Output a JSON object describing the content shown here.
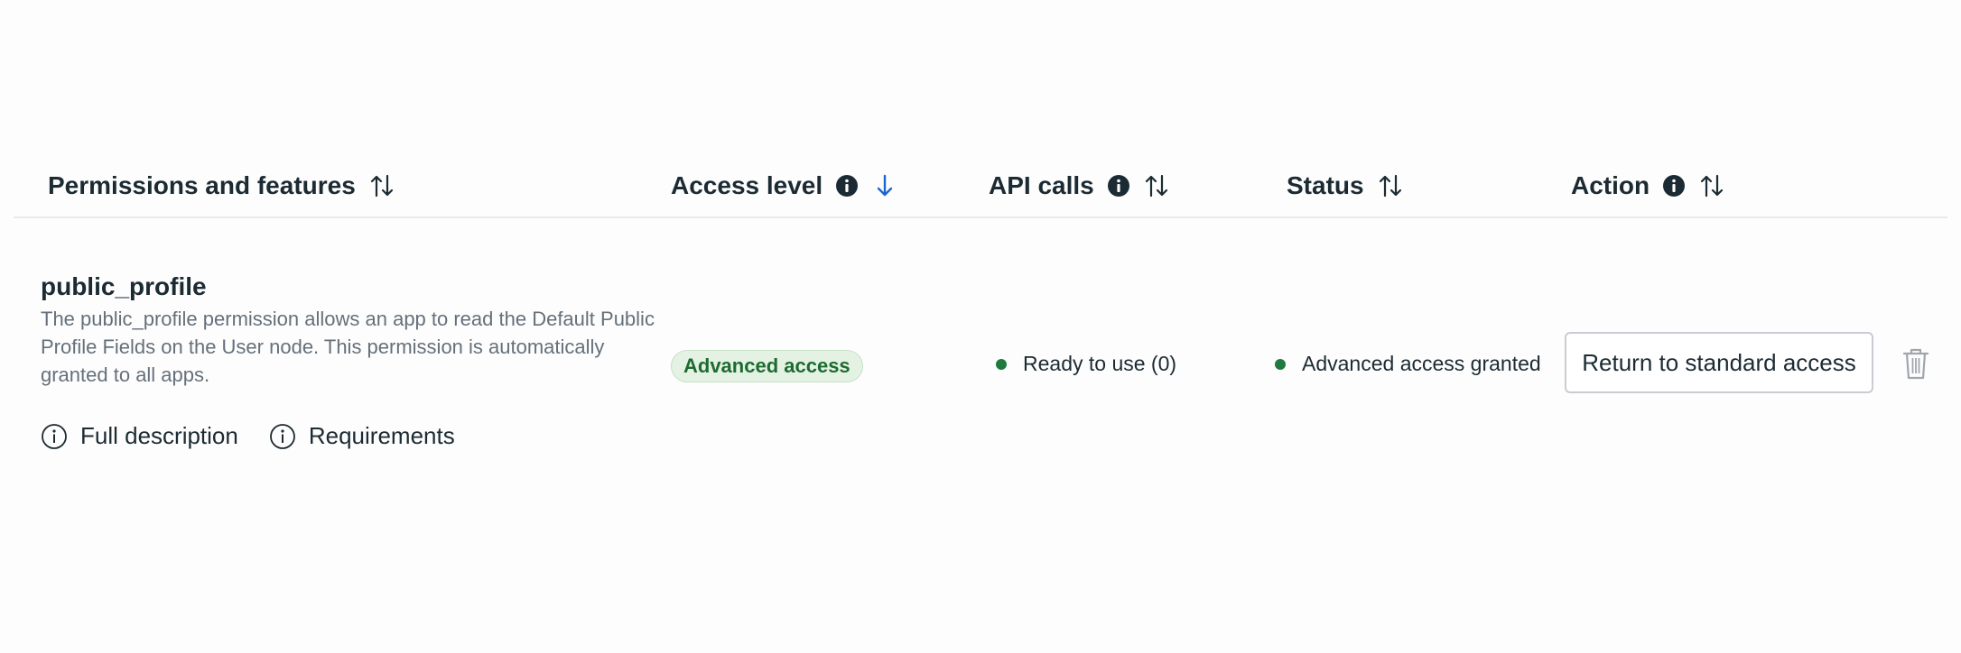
{
  "table": {
    "columns": [
      {
        "label": "Permissions and features",
        "has_info": false,
        "sort_icon": "sort-up-down-icon"
      },
      {
        "label": "Access level",
        "has_info": true,
        "sort_icon": "sort-down-active-icon"
      },
      {
        "label": "API calls",
        "has_info": true,
        "sort_icon": "sort-up-down-icon"
      },
      {
        "label": "Status",
        "has_info": false,
        "sort_icon": "sort-up-down-icon"
      },
      {
        "label": "Action",
        "has_info": true,
        "sort_icon": "sort-up-down-icon"
      }
    ],
    "row": {
      "name": "public_profile",
      "description": "The public_profile permission allows an app to read the Default Public Profile Fields on the User node. This permission is automatically granted to all apps.",
      "links": {
        "full_description": "Full description",
        "requirements": "Requirements"
      },
      "access_level": "Advanced access",
      "api_calls": "Ready to use (0)",
      "status": "Advanced access granted",
      "action_label": "Return to standard access"
    }
  },
  "colors": {
    "text_primary": "#1c2b33",
    "text_secondary": "#65707b",
    "badge_bg": "#e4f2e4",
    "badge_text": "#1e6b2f",
    "status_dot": "#1e7a3e",
    "sort_active": "#1a66d2",
    "divider": "#e8eaed"
  }
}
